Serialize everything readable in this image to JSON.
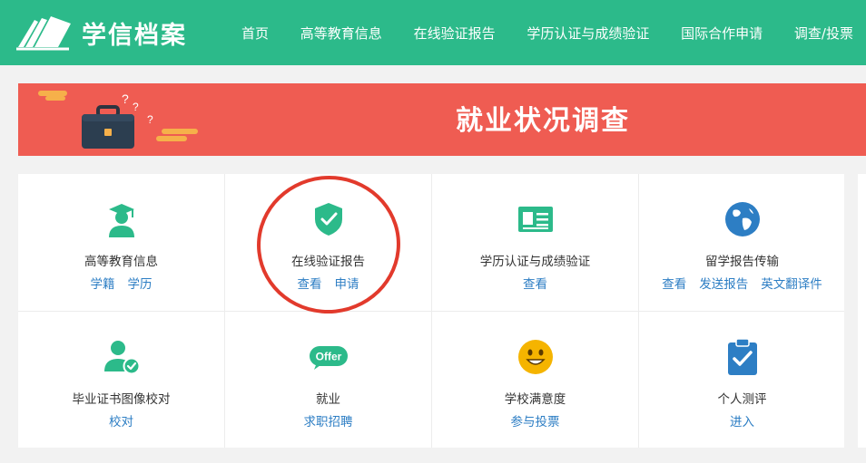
{
  "header": {
    "logo_text": "学信档案",
    "nav": [
      "首页",
      "高等教育信息",
      "在线验证报告",
      "学历认证与成绩验证",
      "国际合作申请",
      "调查/投票"
    ]
  },
  "banner": {
    "title": "就业状况调查"
  },
  "colors": {
    "header_green": "#2cba8a",
    "banner_red": "#ef5c52",
    "icon_green": "#2cba8a",
    "link_blue": "#2d7ec4",
    "highlight_circle": "#e23a2c"
  },
  "grid": {
    "cells": [
      {
        "icon": "graduate-icon",
        "title": "高等教育信息",
        "links": [
          "学籍",
          "学历"
        ]
      },
      {
        "icon": "shield-check-icon",
        "title": "在线验证报告",
        "links": [
          "查看",
          "申请"
        ]
      },
      {
        "icon": "id-card-icon",
        "title": "学历认证与成绩验证",
        "links": [
          "查看"
        ]
      },
      {
        "icon": "globe-icon",
        "title": "留学报告传输",
        "links": [
          "查看",
          "发送报告",
          "英文翻译件"
        ]
      },
      {
        "icon": "user-check-icon",
        "title": "毕业证书图像校对",
        "links": [
          "校对"
        ]
      },
      {
        "icon": "offer-icon",
        "title": "就业",
        "links": [
          "求职招聘"
        ],
        "icon_text": "Offer"
      },
      {
        "icon": "smiley-icon",
        "title": "学校满意度",
        "links": [
          "参与投票"
        ]
      },
      {
        "icon": "clipboard-check-icon",
        "title": "个人测评",
        "links": [
          "进入"
        ]
      }
    ]
  }
}
